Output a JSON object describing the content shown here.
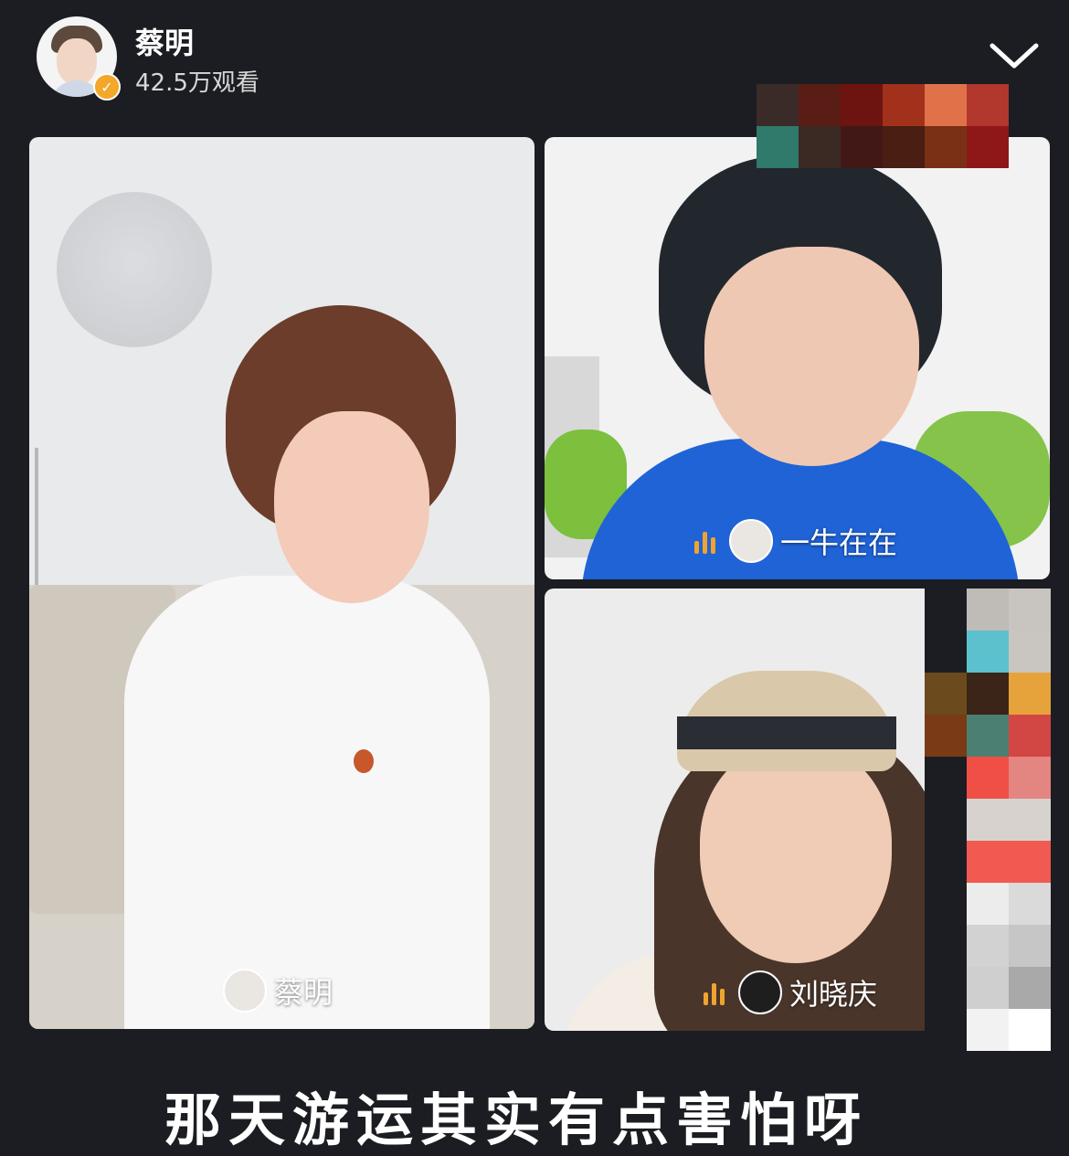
{
  "header": {
    "host_name": "蔡明",
    "viewer_count": "42.5万观看",
    "verified_mark": "✓"
  },
  "icons": {
    "collapse": "chevron-down-icon",
    "mic": "audio-level-icon",
    "verified": "verified-badge-icon"
  },
  "panels": [
    {
      "name": "蔡明"
    },
    {
      "name": "一牛在在"
    },
    {
      "name": "刘晓庆"
    }
  ],
  "caption": "那天游运其实有点害怕呀",
  "colors": {
    "background": "#1b1d22",
    "verified": "#f3a72b",
    "mic": "#f0a32e"
  }
}
